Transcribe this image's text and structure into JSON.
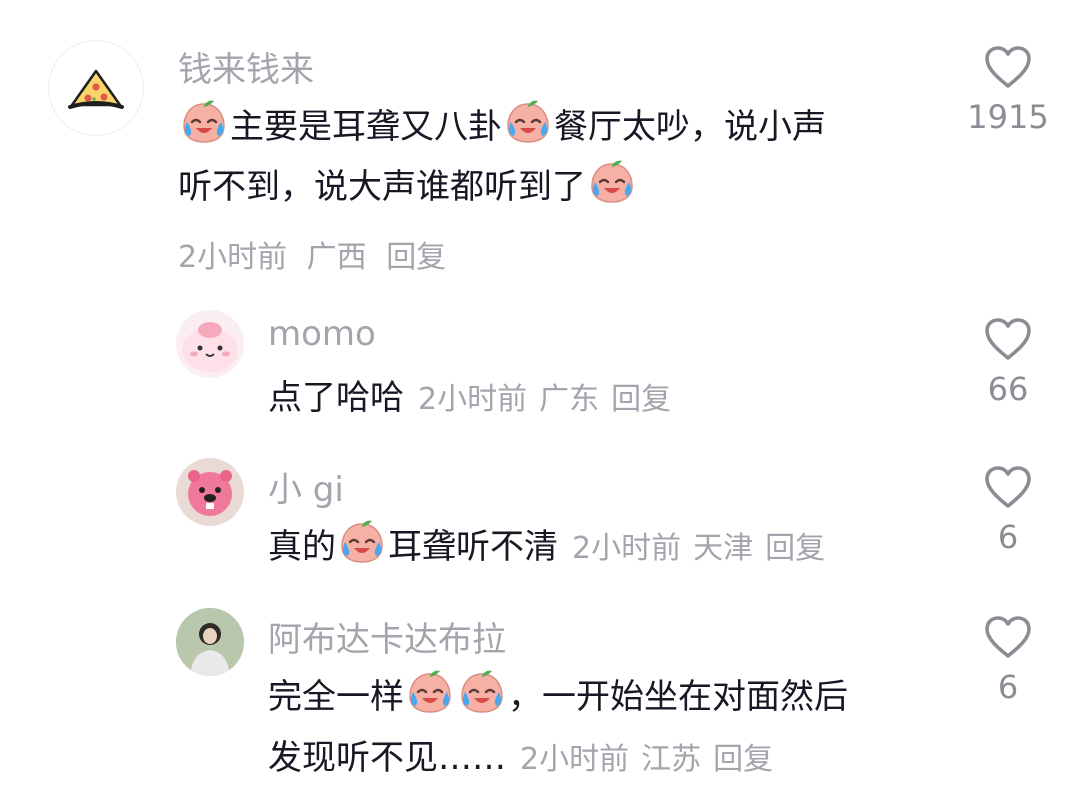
{
  "comments": [
    {
      "username": "钱来钱来",
      "lines": [
        [
          "",
          "主要是耳聋又八卦",
          "",
          "餐厅太吵，说小声"
        ],
        [
          "听不到，说大声谁都听到了",
          ""
        ]
      ],
      "meta": {
        "time": "2小时前",
        "location": "广西",
        "reply": "回复"
      },
      "likes": "1915",
      "avatar_icon": "pizza-slice"
    },
    {
      "username": "momo",
      "text_parts": [
        "点了哈哈"
      ],
      "meta": {
        "time": "2小时前",
        "location": "广东",
        "reply": "回复"
      },
      "likes": "66",
      "avatar_icon": "pink-blob-character"
    },
    {
      "username": "小 gi",
      "text_parts": [
        "真的",
        "",
        "耳聋听不清"
      ],
      "meta": {
        "time": "2小时前",
        "location": "天津",
        "reply": "回复"
      },
      "likes": "6",
      "avatar_icon": "pink-beaver-loopy"
    },
    {
      "username": "阿布达卡达布拉",
      "lines": [
        [
          "完全一样",
          "",
          "",
          "，一开始坐在对面然后"
        ],
        [
          "发现听不见……"
        ]
      ],
      "meta": {
        "time": "2小时前",
        "location": "江苏",
        "reply": "回复"
      },
      "likes": "6",
      "avatar_icon": "person-photo"
    }
  ],
  "icons": {
    "like": "heart-outline-icon",
    "emoji": "crying-laughing-peach-emoji"
  },
  "colors": {
    "muted": "#a3a5ad",
    "text": "#161823",
    "emoji_peach": "#f2a69a"
  }
}
